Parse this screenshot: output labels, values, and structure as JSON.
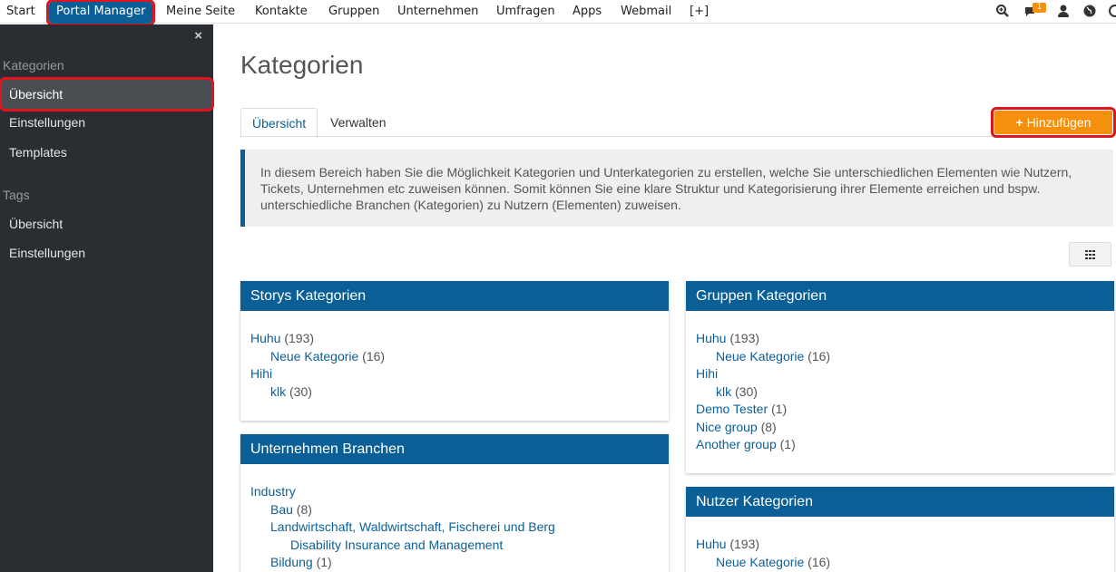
{
  "topnav": {
    "items": [
      "Start",
      "Portal Manager",
      "Meine Seite",
      "Kontakte",
      "Gruppen",
      "Unternehmen",
      "Umfragen",
      "Apps",
      "Webmail",
      "[+]"
    ],
    "notification_count": "1"
  },
  "sidebar": {
    "close": "×",
    "section1": "Kategorien",
    "section1_links": [
      "Übersicht",
      "Einstellungen",
      "Templates"
    ],
    "section2": "Tags",
    "section2_links": [
      "Übersicht",
      "Einstellungen"
    ]
  },
  "main": {
    "title": "Kategorien",
    "tabs": [
      "Übersicht",
      "Verwalten"
    ],
    "add_button": "Hinzufügen",
    "info_text": "In diesem Bereich haben Sie die Möglichkeit Kategorien und Unterkategorien zu erstellen, welche Sie unterschiedlichen Elementen wie Nutzern, Tickets, Unternehmen etc zuweisen können. Somit können Sie eine klare Struktur und Kategorisierung ihrer Elemente erreichen und bspw. unterschiedliche Branchen (Kategorien) zu Nutzern (Elementen) zuweisen."
  },
  "panels": {
    "storys": {
      "title": "Storys Kategorien",
      "items": [
        {
          "name": "Huhu",
          "count": "(193)",
          "level": 0
        },
        {
          "name": "Neue Kategorie",
          "count": "(16)",
          "level": 1
        },
        {
          "name": "Hihi",
          "count": "",
          "level": 0
        },
        {
          "name": "klk",
          "count": "(30)",
          "level": 1
        }
      ]
    },
    "unternehmen": {
      "title": "Unternehmen Branchen",
      "items": [
        {
          "name": "Industry",
          "count": "",
          "level": 0
        },
        {
          "name": "Bau",
          "count": "(8)",
          "level": 1
        },
        {
          "name": "Landwirtschaft, Waldwirtschaft, Fischerei und Berg",
          "count": "",
          "level": 1
        },
        {
          "name": "Disability Insurance and Management",
          "count": "",
          "level": 2
        },
        {
          "name": "Bildung",
          "count": "(1)",
          "level": 1
        }
      ]
    },
    "gruppen": {
      "title": "Gruppen Kategorien",
      "items": [
        {
          "name": "Huhu",
          "count": "(193)",
          "level": 0
        },
        {
          "name": "Neue Kategorie",
          "count": "(16)",
          "level": 1
        },
        {
          "name": "Hihi",
          "count": "",
          "level": 0
        },
        {
          "name": "klk",
          "count": "(30)",
          "level": 1
        },
        {
          "name": "Demo Tester",
          "count": "(1)",
          "level": 0
        },
        {
          "name": "Nice group",
          "count": "(8)",
          "level": 0
        },
        {
          "name": "Another group",
          "count": "(1)",
          "level": 0
        }
      ]
    },
    "nutzer": {
      "title": "Nutzer Kategorien",
      "items": [
        {
          "name": "Huhu",
          "count": "(193)",
          "level": 0
        },
        {
          "name": "Neue Kategorie",
          "count": "(16)",
          "level": 1
        }
      ]
    }
  }
}
